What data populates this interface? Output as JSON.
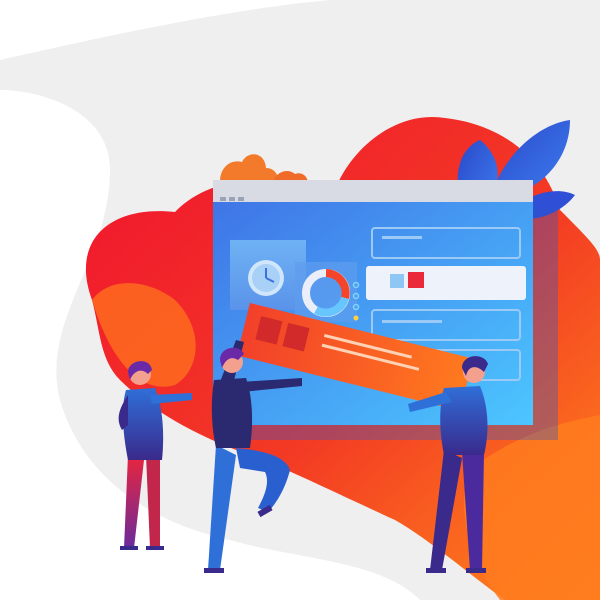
{
  "scene": {
    "description_free": true,
    "colors": {
      "background": "#ffffff",
      "backdrop_gray": "#efefef",
      "blob_red": "#ee1c36",
      "blob_orange": "#ff7a1c",
      "blob_deep_orange": "#f2501f",
      "window_blue": "#3d6fe0",
      "window_light": "#5fa6f2",
      "window_cyan": "#63d2ff",
      "bar_red": "#f4452a",
      "bar_orange": "#ff6a1a",
      "person_purple": "#3a2a8c",
      "person_blue": "#2e6fd8",
      "person_red": "#e5243d",
      "leaf_blue": "#2a4fd1"
    },
    "icons": [
      "clock-icon",
      "donut-chart-icon",
      "leaf-decoration-icon",
      "window-dots-icon"
    ],
    "people_count": 3
  }
}
